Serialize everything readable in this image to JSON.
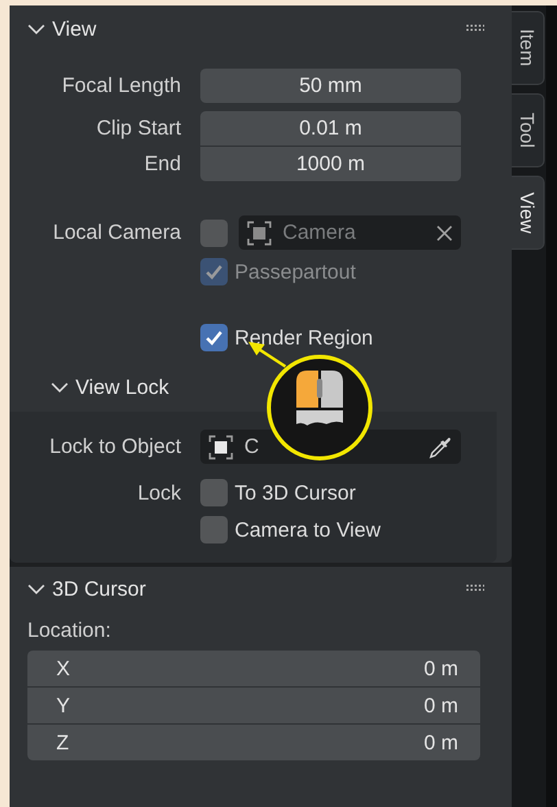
{
  "tabs": [
    {
      "label": "Item",
      "selected": false
    },
    {
      "label": "Tool",
      "selected": false
    },
    {
      "label": "View",
      "selected": true
    }
  ],
  "view": {
    "title": "View",
    "expanded": true,
    "focal_length": {
      "label": "Focal Length",
      "value": "50 mm"
    },
    "clip": [
      {
        "label": "Clip Start",
        "value": "0.01 m"
      },
      {
        "label": "End",
        "value": "1000 m"
      }
    ],
    "local_camera": {
      "label": "Local Camera",
      "checked": false,
      "placeholder": "Camera"
    },
    "passepartout": {
      "label": "Passepartout",
      "checked": true,
      "disabled": true
    },
    "render_region": {
      "label": "Render Region",
      "checked": true,
      "disabled": false
    }
  },
  "view_lock": {
    "title": "View Lock",
    "expanded": true,
    "lock_to_object": {
      "label": "Lock to Object",
      "value": "C"
    },
    "lock": {
      "label": "Lock",
      "options": [
        {
          "label": "To 3D Cursor",
          "checked": false
        },
        {
          "label": "Camera to View",
          "checked": false
        }
      ]
    }
  },
  "cursor": {
    "title": "3D Cursor",
    "expanded": true,
    "location_label": "Location:",
    "axes": [
      {
        "label": "X",
        "value": "0 m"
      },
      {
        "label": "Y",
        "value": "0 m"
      },
      {
        "label": "Z",
        "value": "0 m"
      }
    ]
  }
}
